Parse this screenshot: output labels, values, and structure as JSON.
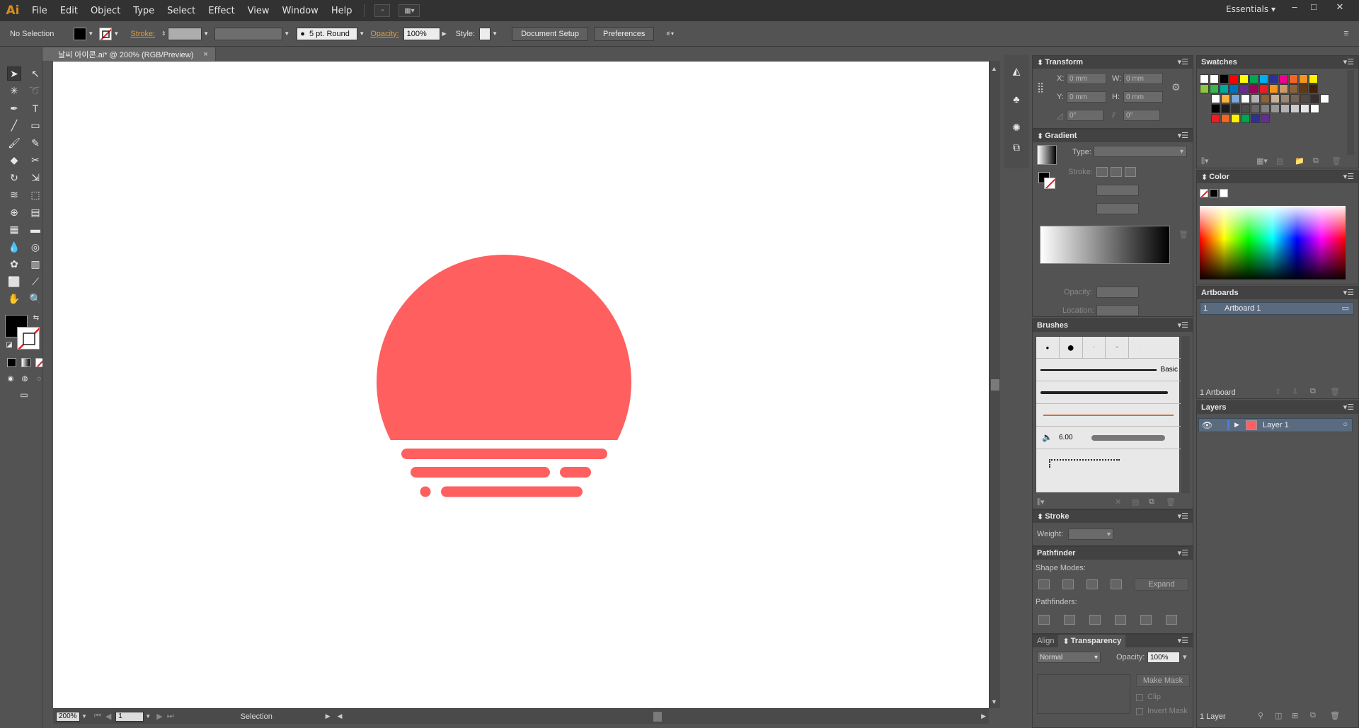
{
  "app": {
    "logo": "Ai",
    "menus": [
      "File",
      "Edit",
      "Object",
      "Type",
      "Select",
      "Effect",
      "View",
      "Window",
      "Help"
    ],
    "workspace": "Essentials",
    "window_controls": [
      "–",
      "□",
      "✕"
    ]
  },
  "control": {
    "selection": "No Selection",
    "stroke_label": "Stroke:",
    "brush_label": "5 pt. Round",
    "opacity_label": "Opacity:",
    "opacity_value": "100%",
    "style_label": "Style:",
    "document_setup": "Document Setup",
    "preferences": "Preferences"
  },
  "document": {
    "tab_title": "날씨 아이콘.ai* @ 200% (RGB/Preview)",
    "tab_close": "×",
    "zoom": "200%",
    "artboard_nav": "1",
    "status": "Selection"
  },
  "artwork": {
    "fill_color": "#ff5f5f",
    "description_icon": "sunset-icon"
  },
  "panels": {
    "transform": {
      "title": "Transform",
      "x_label": "X:",
      "x_value": "0 mm",
      "y_label": "Y:",
      "y_value": "0 mm",
      "w_label": "W:",
      "w_value": "0 mm",
      "h_label": "H:",
      "h_value": "0 mm",
      "rot_value": "0°",
      "shear_value": "0°"
    },
    "gradient": {
      "title": "Gradient",
      "type_label": "Type:",
      "stroke_label": "Stroke:",
      "opacity_label": "Opacity:",
      "location_label": "Location:"
    },
    "brushes": {
      "title": "Brushes",
      "basic_label": "Basic",
      "size_value": "6.00"
    },
    "stroke": {
      "title": "Stroke",
      "weight_label": "Weight:"
    },
    "pathfinder": {
      "title": "Pathfinder",
      "shape_modes": "Shape Modes:",
      "pathfinders": "Pathfinders:",
      "expand": "Expand"
    },
    "align": {
      "title": "Align"
    },
    "transparency": {
      "title": "Transparency",
      "blend_mode": "Normal",
      "opacity_label": "Opacity:",
      "opacity_value": "100%",
      "make_mask": "Make Mask",
      "clip": "Clip",
      "invert_mask": "Invert Mask"
    },
    "swatches": {
      "title": "Swatches"
    },
    "color": {
      "title": "Color"
    },
    "artboards": {
      "title": "Artboards",
      "row_index": "1",
      "row_name": "Artboard 1",
      "count": "1 Artboard"
    },
    "layers": {
      "title": "Layers",
      "layer_name": "Layer 1",
      "count": "1 Layer"
    }
  }
}
